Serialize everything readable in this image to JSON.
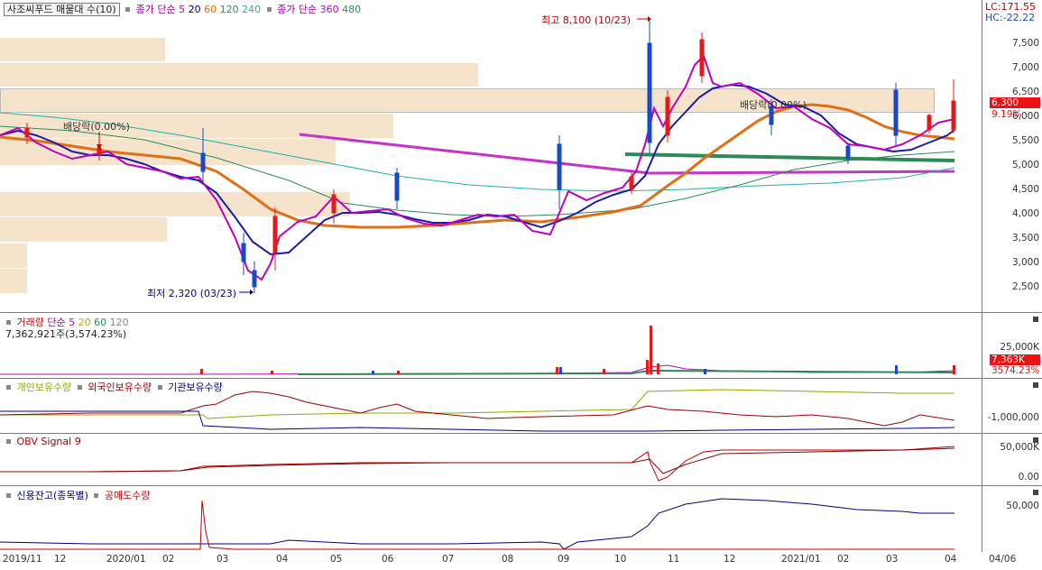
{
  "price_panel": {
    "title": "사조씨푸드 매물대 수(10)",
    "legend": [
      {
        "text": "종가 단순",
        "color": "#9b009b"
      },
      {
        "text": "5",
        "color": "#c000c0"
      },
      {
        "text": "20",
        "color": "#000080"
      },
      {
        "text": "60",
        "color": "#e07000"
      },
      {
        "text": "120",
        "color": "#2e8b57"
      },
      {
        "text": "240",
        "color": "#20b2aa"
      },
      {
        "text": "종가 단순",
        "color": "#9b009b"
      },
      {
        "text": "360",
        "color": "#c000c0"
      },
      {
        "text": "480",
        "color": "#2e8b57"
      }
    ],
    "lc": "LC:171.55",
    "hc": "HC:-22.22",
    "y_ticks": [
      "7,500",
      "7,000",
      "6,500",
      "6,000",
      "5,500",
      "5,000",
      "4,500",
      "4,000",
      "3,500",
      "3,000",
      "2,500"
    ],
    "price_tag": "6,300",
    "pct_tag": "9.19%",
    "high_label": "최고 8,100 (10/23)",
    "low_label": "최저 2,320 (03/23)",
    "dividend_label": "배당락(0.00%)",
    "dividend_label2": "배당락(0.00%)"
  },
  "volume_panel": {
    "legend": [
      {
        "text": "거래량",
        "color": "#c00000"
      },
      {
        "text": "단순",
        "color": "#9b009b"
      },
      {
        "text": "5",
        "color": "#c000c0"
      },
      {
        "text": "20",
        "color": "#c8a000"
      },
      {
        "text": "60",
        "color": "#2e8b57"
      },
      {
        "text": "120",
        "color": "#888888"
      }
    ],
    "sub": "7,362,921주(3,574.23%)",
    "tick": "25,000K",
    "tag": "7,363K",
    "pct": "3574.23%"
  },
  "holder_panel": {
    "legend": [
      {
        "text": "개인보유수량",
        "color": "#8fa800"
      },
      {
        "text": "외국인보유수량",
        "color": "#a00000"
      },
      {
        "text": "기관보유수량",
        "color": "#000080"
      }
    ],
    "tick": "-1,000,000"
  },
  "obv_panel": {
    "legend": [
      {
        "text": "OBV",
        "color": "#c00000"
      },
      {
        "text": "Signal 9",
        "color": "#8b0000"
      }
    ],
    "ticks": [
      "50,000K",
      "0.00"
    ]
  },
  "credit_panel": {
    "legend": [
      {
        "text": "신용잔고(종목별)",
        "color": "#000080"
      },
      {
        "text": "공매도수량",
        "color": "#c00000"
      }
    ],
    "tick": "50,000"
  },
  "x_axis": [
    "2019/11",
    "12",
    "2020/01",
    "02",
    "03",
    "04",
    "05",
    "06",
    "07",
    "08",
    "09",
    "10",
    "11",
    "12",
    "2021/01",
    "02",
    "03",
    "04",
    "04/06"
  ],
  "colors": {
    "up": "#e11b1b",
    "down": "#1a49c8",
    "volume_profile": "#f6e3cc",
    "ma5": "#c000c0",
    "ma20": "#1c1ca8",
    "ma60": "#e07018",
    "ma120": "#2e8b57",
    "ma240": "#20b2aa",
    "trend_magenta": "#c832c8",
    "trend_green": "#2e8b57"
  }
}
